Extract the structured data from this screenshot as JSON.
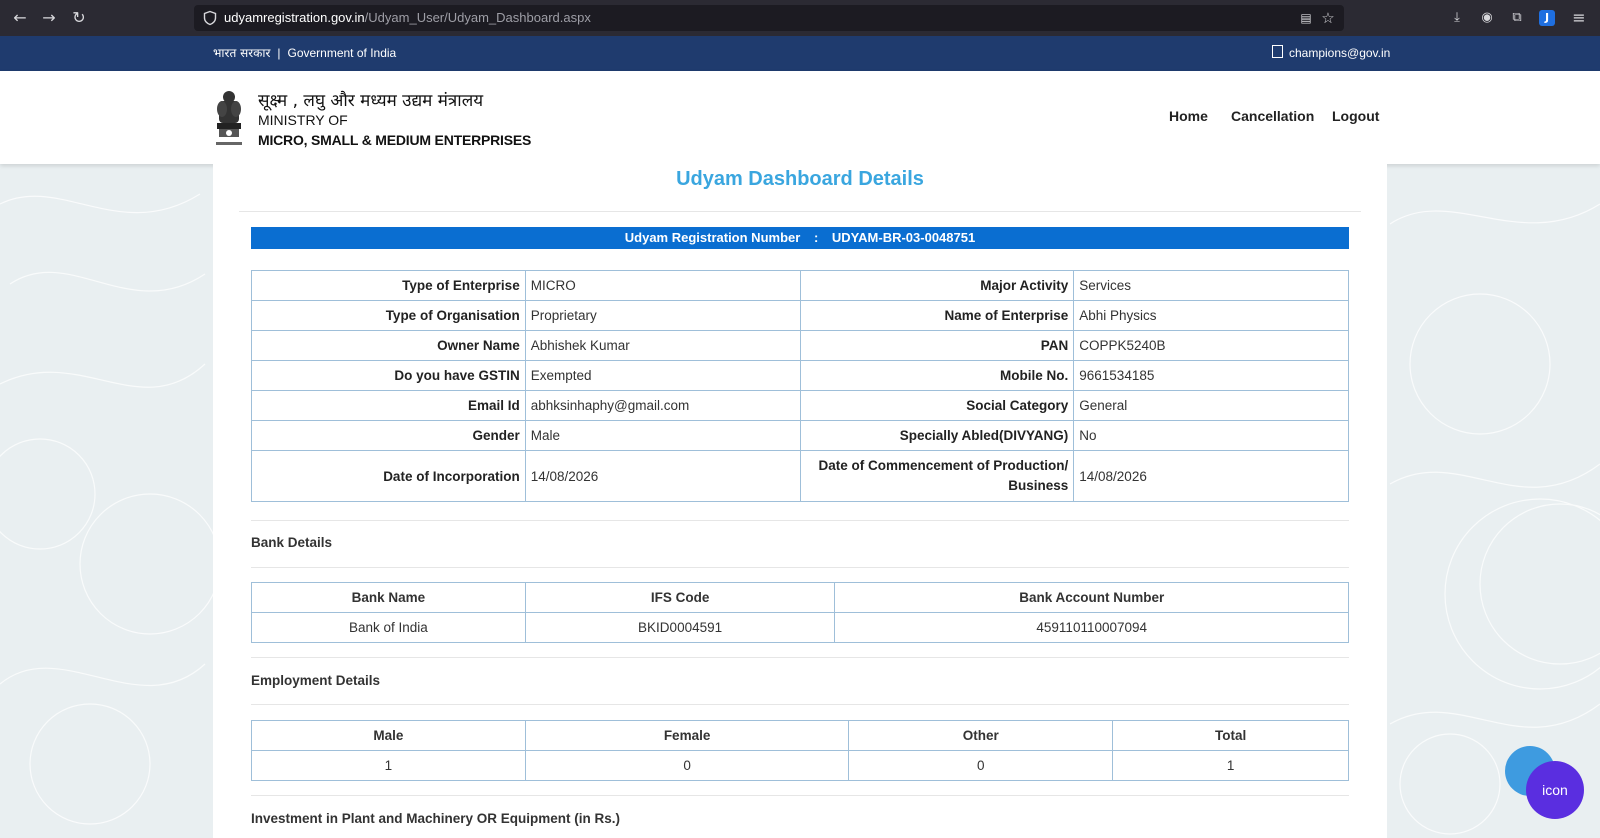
{
  "browser": {
    "back_icon": "←",
    "forward_icon": "→",
    "reload_icon": "↻",
    "site_icon": "shield-icon",
    "url_domain": "udyamregistration.gov.in",
    "url_path": "/Udyam_User/Udyam_Dashboard.aspx",
    "reader_icon": "▤",
    "star_icon": "☆",
    "download_icon": "⤓",
    "account_icon": "◉",
    "extensions_icon": "⧉",
    "ext_j_label": "J",
    "menu_icon": "≡"
  },
  "gov_strip": {
    "hindi": "भारत सरकार",
    "separator": "|",
    "english": "Government of India",
    "email": "champions@gov.in"
  },
  "header": {
    "ministry_hindi": "सूक्ष्म , लघु और मध्यम उद्यम मंत्रालय",
    "ministry_of": "MINISTRY OF",
    "ministry_name": "MICRO, SMALL & MEDIUM ENTERPRISES",
    "nav": [
      "Home",
      "Cancellation",
      "Logout"
    ]
  },
  "page": {
    "title": "Udyam Dashboard Details",
    "reg_label": "Udyam Registration Number",
    "reg_colon": ":",
    "reg_number": "UDYAM-BR-03-0048751"
  },
  "info_rows": [
    {
      "l_label": "Type of Enterprise",
      "l_value": "MICRO",
      "r_label": "Major Activity",
      "r_value": "Services"
    },
    {
      "l_label": "Type of Organisation",
      "l_value": "Proprietary",
      "r_label": "Name of Enterprise",
      "r_value": "Abhi Physics"
    },
    {
      "l_label": "Owner Name",
      "l_value": "Abhishek Kumar",
      "r_label": "PAN",
      "r_value": "COPPK5240B"
    },
    {
      "l_label": "Do you have GSTIN",
      "l_value": "Exempted",
      "r_label": "Mobile No.",
      "r_value": "9661534185"
    },
    {
      "l_label": "Email Id",
      "l_value": "abhksinhaphy@gmail.com",
      "r_label": "Social Category",
      "r_value": "General"
    },
    {
      "l_label": "Gender",
      "l_value": "Male",
      "r_label": "Specially Abled(DIVYANG)",
      "r_value": "No"
    },
    {
      "l_label": "Date of Incorporation",
      "l_value": "14/08/2026",
      "r_label": "Date of Commencement of Production/ Business",
      "r_value": "14/08/2026"
    }
  ],
  "bank": {
    "title": "Bank Details",
    "headers": [
      "Bank Name",
      "IFS Code",
      "Bank Account Number"
    ],
    "row": [
      "Bank of India",
      "BKID0004591",
      "459110110007094"
    ]
  },
  "employment": {
    "title": "Employment Details",
    "headers": [
      "Male",
      "Female",
      "Other",
      "Total"
    ],
    "row": [
      "1",
      "0",
      "0",
      "1"
    ]
  },
  "investment": {
    "title": "Investment in Plant and Machinery OR Equipment (in Rs.)"
  },
  "fab": {
    "label": "icon"
  }
}
